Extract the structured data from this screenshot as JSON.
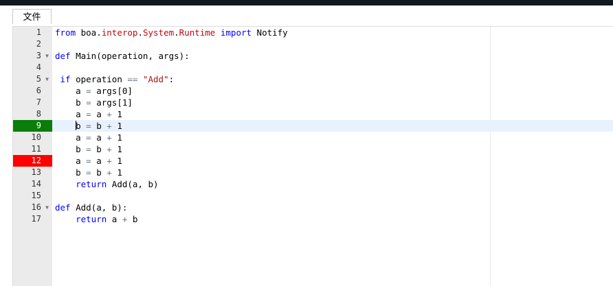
{
  "menu": {
    "file_label": "文件"
  },
  "editor": {
    "active_line": 9,
    "lines": [
      {
        "n": "1",
        "fold": false,
        "marker": "",
        "tokens": [
          {
            "t": "kw",
            "v": "from"
          },
          {
            "t": "",
            "v": " boa."
          },
          {
            "t": "lib",
            "v": "interop"
          },
          {
            "t": "",
            "v": "."
          },
          {
            "t": "lib",
            "v": "System"
          },
          {
            "t": "",
            "v": "."
          },
          {
            "t": "lib",
            "v": "Runtime"
          },
          {
            "t": "",
            "v": " "
          },
          {
            "t": "kw",
            "v": "import"
          },
          {
            "t": "",
            "v": " Notify"
          }
        ]
      },
      {
        "n": "2",
        "fold": false,
        "marker": "",
        "tokens": []
      },
      {
        "n": "3",
        "fold": true,
        "marker": "",
        "tokens": [
          {
            "t": "kw",
            "v": "def"
          },
          {
            "t": "",
            "v": " Main(operation, args):"
          }
        ]
      },
      {
        "n": "4",
        "fold": false,
        "marker": "",
        "tokens": []
      },
      {
        "n": "5",
        "fold": true,
        "marker": "",
        "tokens": [
          {
            "t": "",
            "v": " "
          },
          {
            "t": "kw",
            "v": "if"
          },
          {
            "t": "",
            "v": " operation "
          },
          {
            "t": "op",
            "v": "=="
          },
          {
            "t": "",
            "v": " "
          },
          {
            "t": "str",
            "v": "\"Add\""
          },
          {
            "t": "",
            "v": ":"
          }
        ]
      },
      {
        "n": "6",
        "fold": false,
        "marker": "",
        "tokens": [
          {
            "t": "",
            "v": "    a "
          },
          {
            "t": "op",
            "v": "="
          },
          {
            "t": "",
            "v": " args[0]"
          }
        ]
      },
      {
        "n": "7",
        "fold": false,
        "marker": "",
        "tokens": [
          {
            "t": "",
            "v": "    b "
          },
          {
            "t": "op",
            "v": "="
          },
          {
            "t": "",
            "v": " args[1]"
          }
        ]
      },
      {
        "n": "8",
        "fold": false,
        "marker": "",
        "tokens": [
          {
            "t": "",
            "v": "    a "
          },
          {
            "t": "op",
            "v": "="
          },
          {
            "t": "",
            "v": " a "
          },
          {
            "t": "op",
            "v": "+"
          },
          {
            "t": "",
            "v": " 1"
          }
        ]
      },
      {
        "n": "9",
        "fold": false,
        "marker": "green",
        "tokens": [
          {
            "t": "",
            "v": "    "
          },
          {
            "t": "cursor",
            "v": ""
          },
          {
            "t": "",
            "v": "b "
          },
          {
            "t": "op",
            "v": "="
          },
          {
            "t": "",
            "v": " b "
          },
          {
            "t": "op",
            "v": "+"
          },
          {
            "t": "",
            "v": " 1"
          }
        ]
      },
      {
        "n": "10",
        "fold": false,
        "marker": "",
        "tokens": [
          {
            "t": "",
            "v": "    a "
          },
          {
            "t": "op",
            "v": "="
          },
          {
            "t": "",
            "v": " a "
          },
          {
            "t": "op",
            "v": "+"
          },
          {
            "t": "",
            "v": " 1"
          }
        ]
      },
      {
        "n": "11",
        "fold": false,
        "marker": "",
        "tokens": [
          {
            "t": "",
            "v": "    b "
          },
          {
            "t": "op",
            "v": "="
          },
          {
            "t": "",
            "v": " b "
          },
          {
            "t": "op",
            "v": "+"
          },
          {
            "t": "",
            "v": " 1"
          }
        ]
      },
      {
        "n": "12",
        "fold": false,
        "marker": "red",
        "tokens": [
          {
            "t": "",
            "v": "    a "
          },
          {
            "t": "op",
            "v": "="
          },
          {
            "t": "",
            "v": " a "
          },
          {
            "t": "op",
            "v": "+"
          },
          {
            "t": "",
            "v": " 1"
          }
        ]
      },
      {
        "n": "13",
        "fold": false,
        "marker": "",
        "tokens": [
          {
            "t": "",
            "v": "    b "
          },
          {
            "t": "op",
            "v": "="
          },
          {
            "t": "",
            "v": " b "
          },
          {
            "t": "op",
            "v": "+"
          },
          {
            "t": "",
            "v": " 1"
          }
        ]
      },
      {
        "n": "14",
        "fold": false,
        "marker": "",
        "tokens": [
          {
            "t": "",
            "v": "    "
          },
          {
            "t": "kw",
            "v": "return"
          },
          {
            "t": "",
            "v": " Add(a, b)"
          }
        ]
      },
      {
        "n": "15",
        "fold": false,
        "marker": "",
        "tokens": []
      },
      {
        "n": "16",
        "fold": true,
        "marker": "",
        "tokens": [
          {
            "t": "kw",
            "v": "def"
          },
          {
            "t": "",
            "v": " Add(a, b):"
          }
        ]
      },
      {
        "n": "17",
        "fold": false,
        "marker": "",
        "tokens": [
          {
            "t": "",
            "v": "    "
          },
          {
            "t": "kw",
            "v": "return"
          },
          {
            "t": "",
            "v": " a "
          },
          {
            "t": "op",
            "v": "+"
          },
          {
            "t": "",
            "v": " b"
          }
        ]
      }
    ]
  },
  "icons": {
    "fold": "fold-arrow-icon"
  },
  "colors": {
    "topbar": "#101820",
    "gutter": "#ebebeb",
    "active_line": "#e8f2fe",
    "breakpoint_green": "#0a7d0a",
    "breakpoint_red": "#ff0000",
    "keyword": "#0000ff",
    "library": "#c5060b",
    "string": "#a31515"
  }
}
